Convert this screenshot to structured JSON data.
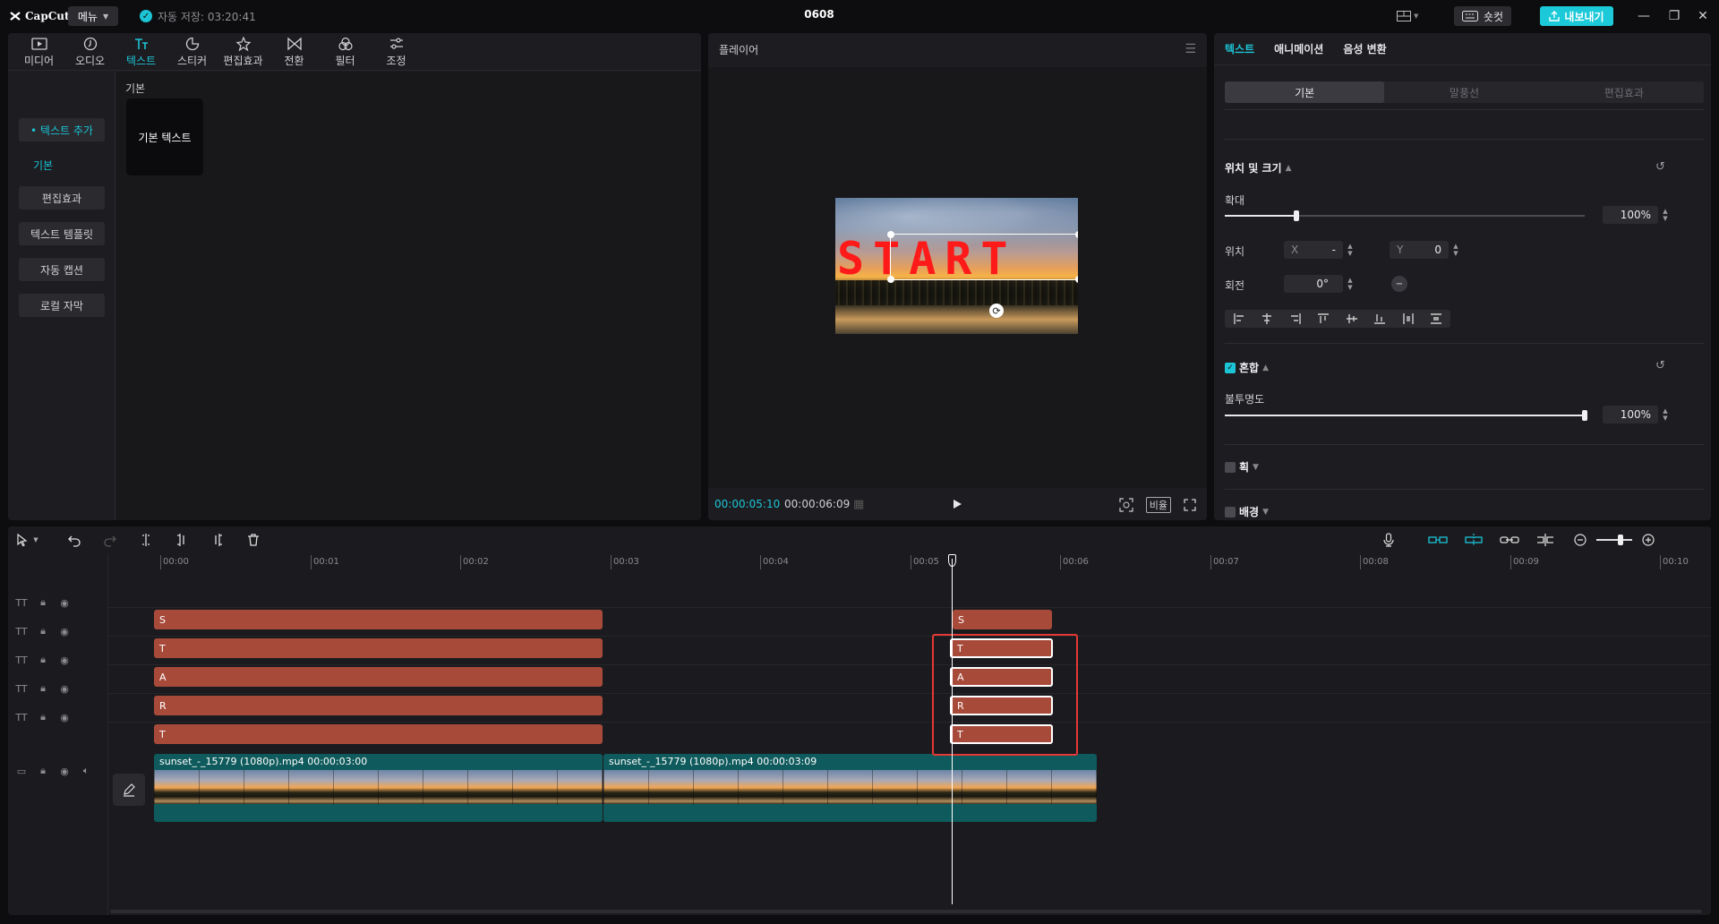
{
  "app": {
    "logo_text": "CapCut",
    "menu_label": "메뉴",
    "autosave_text": "자동 저장: 03:20:41",
    "project_title": "0608",
    "shortcut_label": "숏컷",
    "export_label": "내보내기",
    "accent_color": "#1cc4d6"
  },
  "media_panel": {
    "tabs": [
      {
        "label": "미디어",
        "icon": "media-icon"
      },
      {
        "label": "오디오",
        "icon": "audio-icon"
      },
      {
        "label": "텍스트",
        "icon": "text-icon",
        "active": true
      },
      {
        "label": "스티커",
        "icon": "sticker-icon"
      },
      {
        "label": "편집효과",
        "icon": "effects-icon"
      },
      {
        "label": "전환",
        "icon": "transition-icon"
      },
      {
        "label": "필터",
        "icon": "filter-icon"
      },
      {
        "label": "조정",
        "icon": "adjust-icon"
      }
    ],
    "side_items": {
      "add_text": "• 텍스트 추가",
      "basic_sub": "기본",
      "effects": "편집효과",
      "templates": "텍스트 템플릿",
      "auto_caption": "자동 캡션",
      "local_caption": "로컬 자막"
    },
    "section_label": "기본",
    "card_label": "기본 텍스트"
  },
  "player": {
    "title": "플레이어",
    "preview_text": "START",
    "time_current": "00:00:05:10",
    "time_total": "00:00:06:09",
    "ratio_label": "비율"
  },
  "properties": {
    "tabs": [
      "텍스트",
      "애니메이션",
      "음성 변환"
    ],
    "subtabs": [
      "기본",
      "말풍선",
      "편집효과"
    ],
    "position_size": {
      "title": "위치 및 크기",
      "scale_label": "확대",
      "scale_value": "100%",
      "scale_fraction": 0.2,
      "position_label": "위치",
      "x_axis": "X",
      "x_value": "-",
      "y_axis": "Y",
      "y_value": "0",
      "rotation_label": "회전",
      "rotation_value": "0°"
    },
    "blend": {
      "title": "혼합",
      "opacity_label": "불투명도",
      "opacity_value": "100%",
      "opacity_fraction": 1.0
    },
    "stroke_title": "획",
    "background_title": "배경"
  },
  "timeline": {
    "ruler": [
      "00:00",
      "00:01",
      "00:02",
      "00:03",
      "00:04",
      "00:05",
      "00:06",
      "00:07",
      "00:08",
      "00:09",
      "00:10"
    ],
    "text_tracks": [
      {
        "left_label": "S",
        "right_label": "S"
      },
      {
        "left_label": "T",
        "right_label": "T"
      },
      {
        "left_label": "A",
        "right_label": "A"
      },
      {
        "left_label": "R",
        "right_label": "R"
      },
      {
        "left_label": "T",
        "right_label": "T"
      }
    ],
    "video_clips": [
      {
        "label": "sunset_-_15779 (1080p).mp4   00:00:03:00"
      },
      {
        "label": "sunset_-_15779 (1080p).mp4   00:00:03:09"
      }
    ]
  }
}
